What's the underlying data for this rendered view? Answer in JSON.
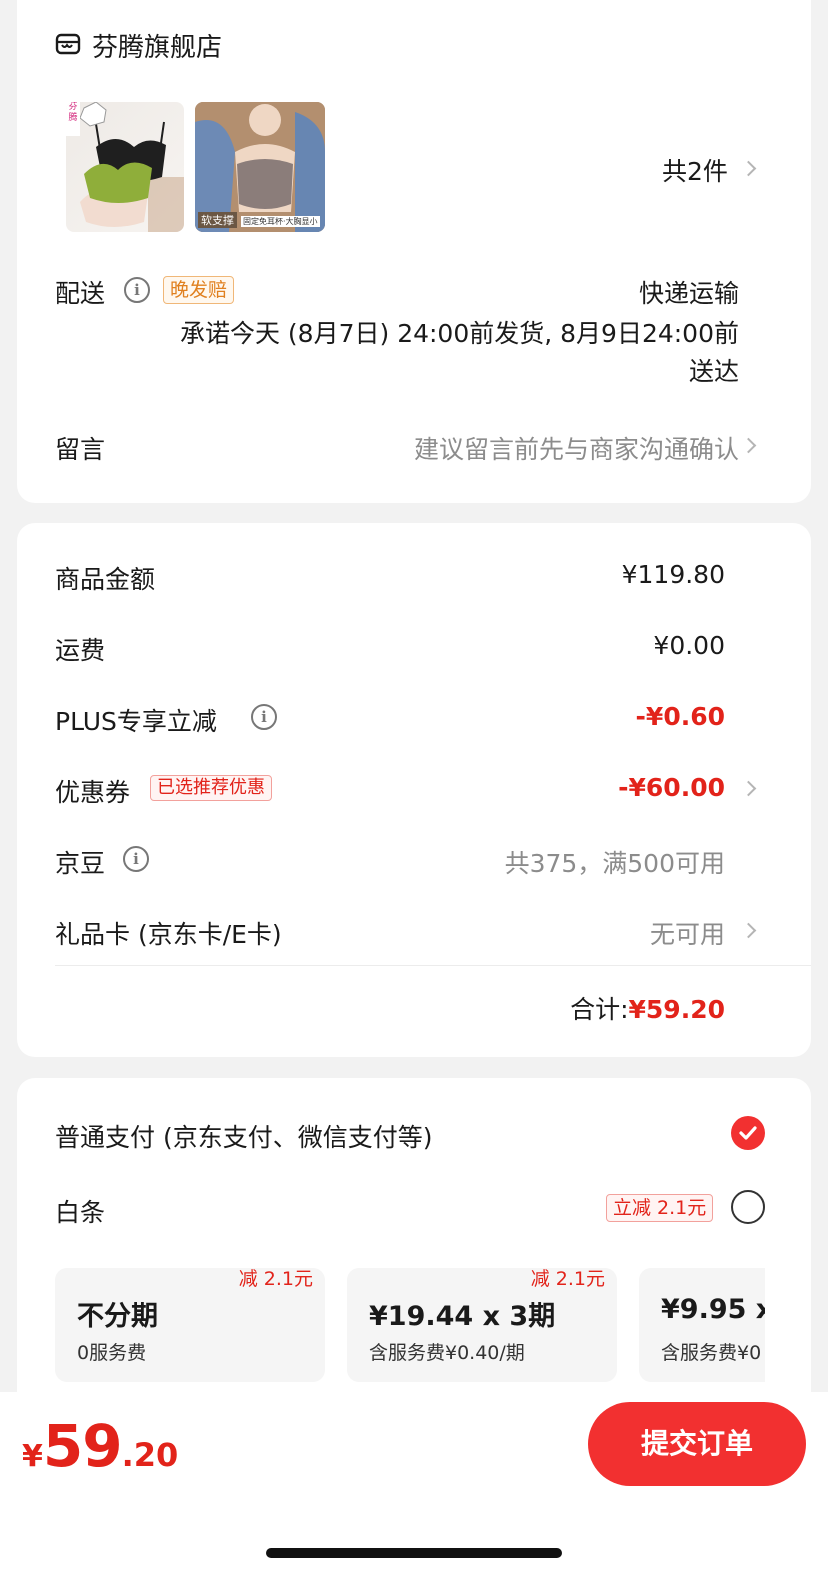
{
  "store": {
    "name": "芬腾旗舰店",
    "icon": "store-icon",
    "count_label": "共2件"
  },
  "products": [
    {
      "badge": "芬腾",
      "colors": [
        "#1f1f1f",
        "#8fae3a",
        "#f2dcd0"
      ]
    },
    {
      "badge": "软支撑",
      "caption": "固定免耳杯·大胸显小"
    }
  ],
  "delivery": {
    "label": "配送",
    "tag": "晚发赔",
    "method": "快递运输",
    "promise_line1": "承诺今天 (8月7日) 24:00前发货, 8月9日24:00前",
    "promise_line2": "送达"
  },
  "message": {
    "label": "留言",
    "placeholder": "建议留言前先与商家沟通确认"
  },
  "summary": {
    "goods_label": "商品金额",
    "goods_value": "¥119.80",
    "shipping_label": "运费",
    "shipping_value": "¥0.00",
    "plus_label": "PLUS专享立减",
    "plus_value": "-¥0.60",
    "coupon_label": "优惠券",
    "coupon_tag": "已选推荐优惠",
    "coupon_value": "-¥60.00",
    "beans_label": "京豆",
    "beans_value": "共375，满500可用",
    "giftcard_label": "礼品卡 (京东卡/E卡)",
    "giftcard_value": "无可用",
    "total_label": "合计:",
    "total_value": "¥59.20"
  },
  "payment": {
    "normal_label": "普通支付 (京东支付、微信支付等)",
    "baitiao_label": "白条",
    "baitiao_tag": "立减 2.1元",
    "plans": [
      {
        "title": "不分期",
        "sub": "0服务费",
        "badge": "减 2.1元"
      },
      {
        "title": "¥19.44 x 3期",
        "sub": "含服务费¥0.40/期",
        "badge": "减 2.1元"
      },
      {
        "title": "¥9.95 x",
        "sub": "含服务费¥0",
        "badge": ""
      }
    ]
  },
  "footer": {
    "price_symbol": "¥",
    "price_int": "59",
    "price_dec": ".20",
    "submit_label": "提交订单"
  },
  "colors": {
    "accent": "#e2231a",
    "button": "#f23030"
  }
}
